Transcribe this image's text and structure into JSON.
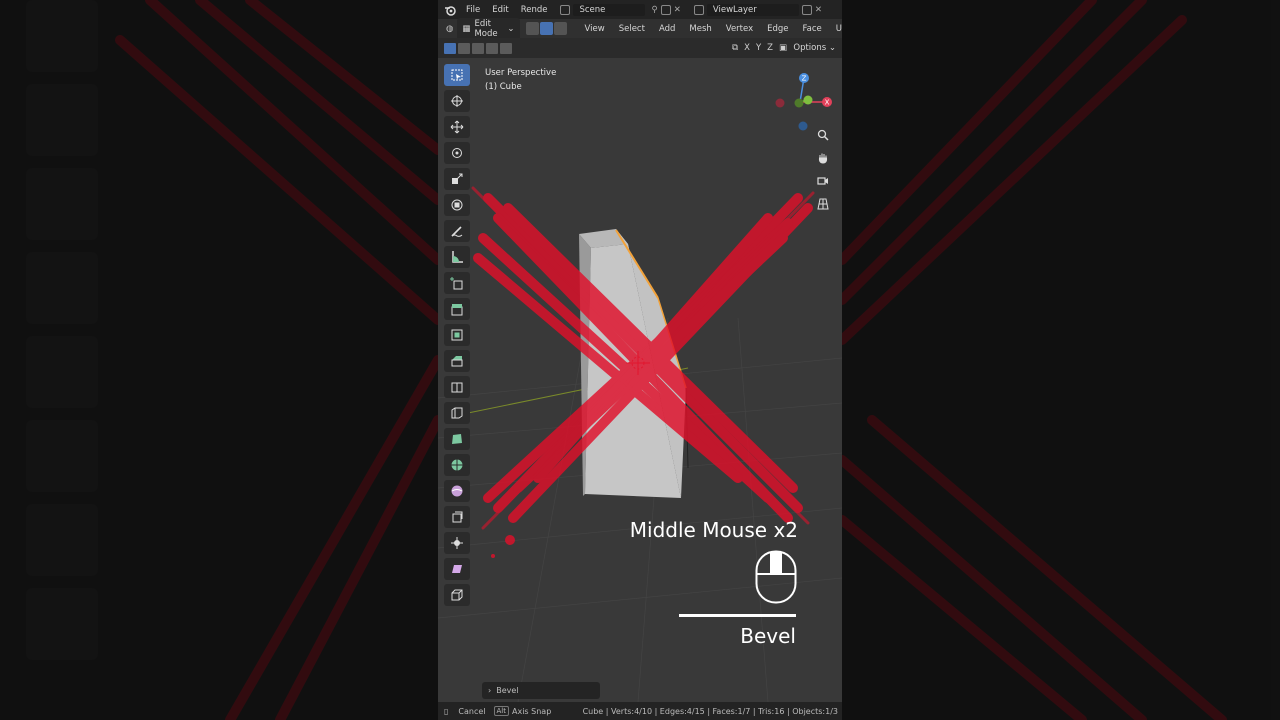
{
  "topbar": {
    "menus": [
      "File",
      "Edit",
      "Rende"
    ],
    "scene_name": "Scene",
    "view_layer": "ViewLayer"
  },
  "header": {
    "mode": "Edit Mode",
    "menus": [
      "View",
      "Select",
      "Add",
      "Mesh",
      "Vertex",
      "Edge",
      "Face",
      "U"
    ]
  },
  "header2": {
    "axes": [
      "X",
      "Y",
      "Z"
    ],
    "options_label": "Options"
  },
  "viewport": {
    "perspective": "User Perspective",
    "object": "(1) Cube"
  },
  "gizmo": {
    "z": "Z",
    "x": "X"
  },
  "tutorial": {
    "shortcut": "Middle Mouse x2",
    "operation": "Bevel"
  },
  "last_operator": "Bevel",
  "statusbar": {
    "cancel": "Cancel",
    "alt_key": "Alt",
    "axis_snap": "Axis Snap",
    "stats": "Cube | Verts:4/10 | Edges:4/15 | Faces:1/7 | Tris:16 | Objects:1/3"
  },
  "colors": {
    "accent": "#4772b3",
    "overlay_red": "#e0102a",
    "bevel_orange": "#f2a23a",
    "axis_x": "#e2405a",
    "axis_y": "#7fbf3f",
    "axis_z": "#4a8fe0"
  },
  "icons": {
    "toolbar": [
      "select-box-icon",
      "cursor-icon",
      "move-icon",
      "rotate-icon",
      "scale-icon",
      "transform-icon",
      "annotate-icon",
      "measure-icon",
      "add-cube-icon",
      "extrude-icon",
      "inset-icon",
      "bevel-icon",
      "loop-cut-icon",
      "knife-icon",
      "poly-build-icon",
      "spin-icon",
      "smooth-icon",
      "edge-slide-icon",
      "shrink-fatten-icon",
      "shear-icon",
      "rip-icon"
    ]
  }
}
